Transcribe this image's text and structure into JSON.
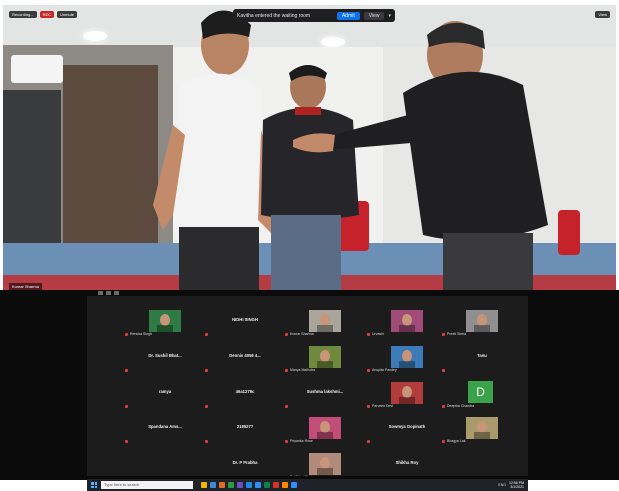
{
  "meeting": {
    "notice_text": "Kavitha entered the waiting room",
    "admit_label": "Admit",
    "view_label": "View",
    "caret": "▾",
    "top_left_labels": [
      "Recording...",
      "REC",
      "Unmute"
    ],
    "top_right_label": "View",
    "speaker_tag": "Kumar Sharma"
  },
  "gallery": {
    "tiles": [
      {
        "name": "",
        "sub": "Renuka Singh",
        "thumb": "video",
        "color": "#2f7b45"
      },
      {
        "name": "NIDHI SINGH",
        "sub": "",
        "thumb": ""
      },
      {
        "name": "",
        "sub": "Kumar Sharma",
        "thumb": "video",
        "color": "#a9a59c"
      },
      {
        "name": "",
        "sub": "Urvashi",
        "thumb": "video",
        "color": "#a04a78"
      },
      {
        "name": "",
        "sub": "Preeti Sinha",
        "thumb": "video",
        "color": "#8f8f8f"
      },
      {
        "name": "Dr. Sushil Bhat...",
        "sub": "",
        "thumb": ""
      },
      {
        "name": "Dennis 4059 4...",
        "sub": "",
        "thumb": ""
      },
      {
        "name": "",
        "sub": "Manya Malhotra",
        "thumb": "video",
        "color": "#6f8a3d"
      },
      {
        "name": "",
        "sub": "Anupita Pandey",
        "thumb": "video",
        "color": "#3c7bb8"
      },
      {
        "name": "Tanu",
        "sub": "",
        "thumb": ""
      },
      {
        "name": "ramya",
        "sub": "",
        "thumb": ""
      },
      {
        "name": "46a1279c",
        "sub": "",
        "thumb": ""
      },
      {
        "name": "Sushma lakshmi...",
        "sub": "",
        "thumb": ""
      },
      {
        "name": "",
        "sub": "Parveen Devi",
        "thumb": "video",
        "color": "#b23b3b"
      },
      {
        "name": "",
        "sub": "Deepika Chandra",
        "thumb": "avatar",
        "letter": "D"
      },
      {
        "name": "Spandana Ams...",
        "sub": "",
        "thumb": ""
      },
      {
        "name": "2185277",
        "sub": "",
        "thumb": ""
      },
      {
        "name": "",
        "sub": "Priyanka Rose",
        "thumb": "video",
        "color": "#c24d78"
      },
      {
        "name": "Sowmya Gopinath",
        "sub": "",
        "thumb": ""
      },
      {
        "name": "",
        "sub": "Bhagya Lak",
        "thumb": "video",
        "color": "#a89a6a"
      },
      {
        "name": "Dr. P Prabha",
        "sub": "",
        "thumb": ""
      },
      {
        "name": "",
        "sub": "Dr. Prisa Singh",
        "thumb": "video",
        "color": "#b08a7a"
      },
      {
        "name": "Shikha Roy",
        "sub": "",
        "thumb": ""
      }
    ]
  },
  "taskbar": {
    "search_placeholder": "Type here to search",
    "tray_text": "ENG",
    "time": "12:56 PM",
    "date": "3/1/2021",
    "icon_colors": [
      "#f5b700",
      "#3b88d8",
      "#e36a1f",
      "#2c9a3e",
      "#6a4fc6",
      "#1e88e5",
      "#2d8cff",
      "#0b8043",
      "#d93025",
      "#ff8a00",
      "#2d8cff"
    ]
  }
}
